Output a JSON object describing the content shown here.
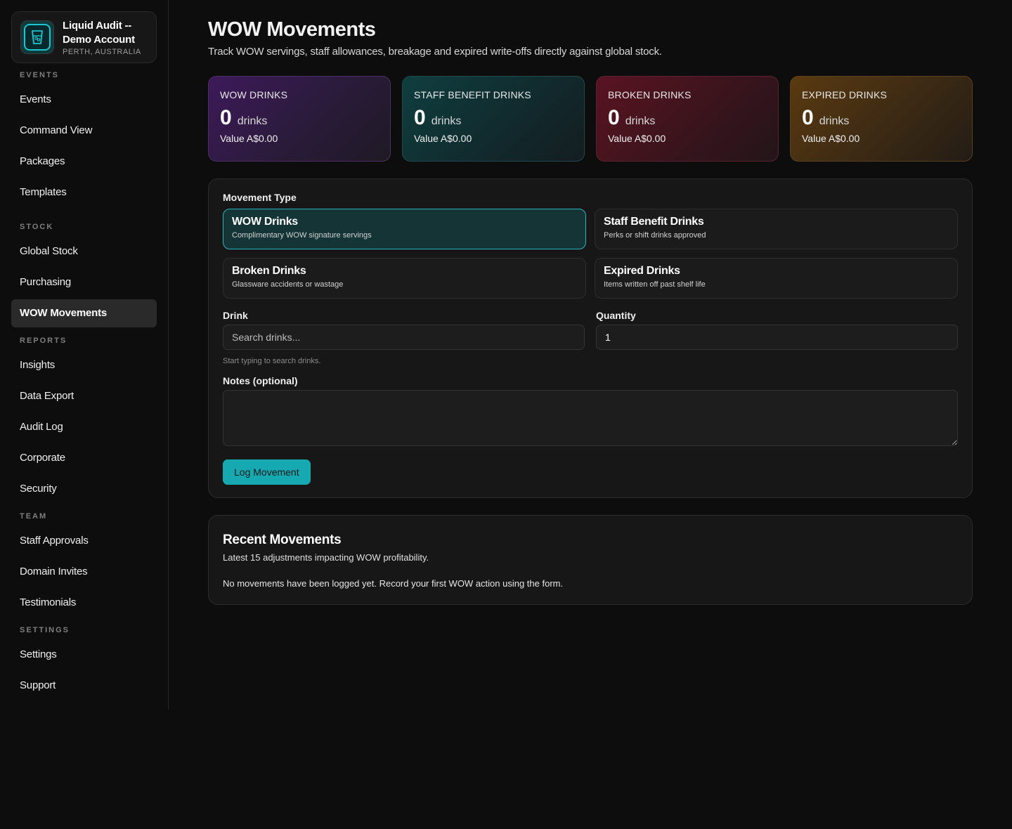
{
  "sidebar": {
    "account": {
      "name": "Liquid Audit -- Demo Account",
      "location": "PERTH, AUSTRALIA",
      "logo_icon": "glass-icon"
    },
    "sections": [
      {
        "label": "EVENTS",
        "items": [
          {
            "label": "Events"
          },
          {
            "label": "Command View"
          },
          {
            "label": "Packages"
          },
          {
            "label": "Templates"
          }
        ]
      },
      {
        "label": "STOCK",
        "items": [
          {
            "label": "Global Stock"
          },
          {
            "label": "Purchasing"
          },
          {
            "label": "WOW Movements",
            "active": true
          }
        ]
      },
      {
        "label": "REPORTS",
        "items": [
          {
            "label": "Insights"
          },
          {
            "label": "Data Export"
          },
          {
            "label": "Audit Log"
          },
          {
            "label": "Corporate"
          },
          {
            "label": "Security"
          }
        ]
      },
      {
        "label": "TEAM",
        "items": [
          {
            "label": "Staff Approvals"
          },
          {
            "label": "Domain Invites"
          },
          {
            "label": "Testimonials"
          }
        ]
      },
      {
        "label": "SETTINGS",
        "items": [
          {
            "label": "Settings"
          },
          {
            "label": "Support"
          }
        ]
      }
    ]
  },
  "header": {
    "title": "WOW Movements",
    "subtitle": "Track WOW servings, staff allowances, breakage and expired write-offs directly against global stock."
  },
  "stats": [
    {
      "label": "WOW DRINKS",
      "count": "0",
      "unit": "drinks",
      "value": "Value A$0.00",
      "color": "#3d1a5a"
    },
    {
      "label": "STAFF BENEFIT DRINKS",
      "count": "0",
      "unit": "drinks",
      "value": "Value A$0.00",
      "color": "#0f3e3f"
    },
    {
      "label": "BROKEN DRINKS",
      "count": "0",
      "unit": "drinks",
      "value": "Value A$0.00",
      "color": "#5a1322"
    },
    {
      "label": "EXPIRED DRINKS",
      "count": "0",
      "unit": "drinks",
      "value": "Value A$0.00",
      "color": "#5a3a10"
    }
  ],
  "form": {
    "movement_type_label": "Movement Type",
    "types": [
      {
        "title": "WOW Drinks",
        "desc": "Complimentary WOW signature servings",
        "selected": true
      },
      {
        "title": "Staff Benefit Drinks",
        "desc": "Perks or shift drinks approved"
      },
      {
        "title": "Broken Drinks",
        "desc": "Glassware accidents or wastage"
      },
      {
        "title": "Expired Drinks",
        "desc": "Items written off past shelf life"
      }
    ],
    "drink_label": "Drink",
    "drink_placeholder": "Search drinks...",
    "drink_hint": "Start typing to search drinks.",
    "quantity_label": "Quantity",
    "quantity_value": "1",
    "notes_label": "Notes (optional)",
    "notes_value": "",
    "submit_label": "Log Movement",
    "accent": "#16a9b2"
  },
  "recent": {
    "title": "Recent Movements",
    "subtitle": "Latest 15 adjustments impacting WOW profitability.",
    "empty": "No movements have been logged yet. Record your first WOW action using the form."
  }
}
